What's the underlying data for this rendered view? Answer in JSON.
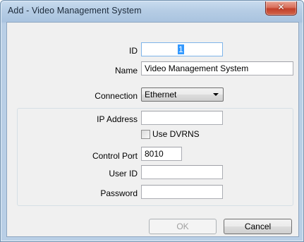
{
  "window": {
    "title": "Add - Video Management System",
    "close_glyph": "✕"
  },
  "form": {
    "id": {
      "label": "ID",
      "value": "1"
    },
    "name": {
      "label": "Name",
      "value": "Video Management System"
    },
    "connection": {
      "label": "Connection",
      "selected": "Ethernet"
    },
    "ip_address": {
      "label": "IP Address",
      "value": ""
    },
    "use_dvrns": {
      "label": "Use DVRNS",
      "checked": false
    },
    "control_port": {
      "label": "Control Port",
      "value": "8010"
    },
    "user_id": {
      "label": "User ID",
      "value": ""
    },
    "password": {
      "label": "Password",
      "value": ""
    }
  },
  "buttons": {
    "ok_label": "OK",
    "ok_enabled": false,
    "cancel_label": "Cancel"
  },
  "colors": {
    "selection_highlight": "#3399ff",
    "title_bar": "#b6cde5",
    "close_button": "#c2402a",
    "dialog_background": "#f0f0f0"
  }
}
